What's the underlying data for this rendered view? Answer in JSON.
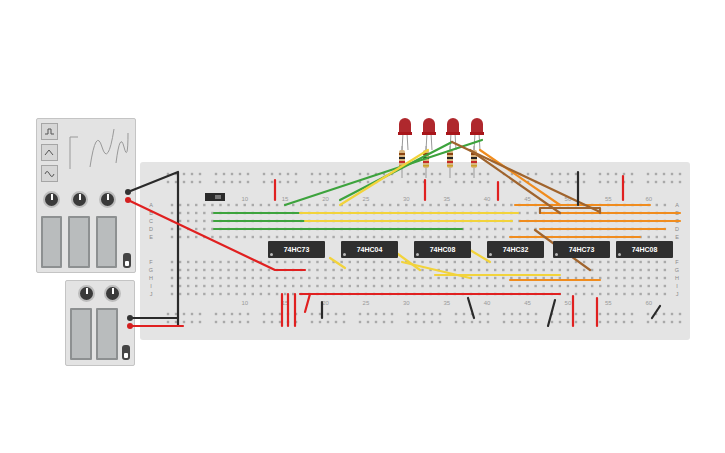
{
  "breadboard": {
    "column_labels_top": [
      "10",
      "15",
      "20",
      "25",
      "30",
      "35",
      "40",
      "45",
      "50",
      "55",
      "60"
    ],
    "column_labels_bottom": [
      "10",
      "15",
      "20",
      "25",
      "30",
      "35",
      "40",
      "45",
      "50",
      "55",
      "60"
    ],
    "rows_top": [
      "A",
      "B",
      "C",
      "D",
      "E"
    ],
    "rows_bottom": [
      "F",
      "G",
      "H",
      "I",
      "J"
    ]
  },
  "chips": [
    {
      "label": "74HC73"
    },
    {
      "label": "74HC04"
    },
    {
      "label": "74HC08"
    },
    {
      "label": "74HC32"
    },
    {
      "label": "74HC73"
    },
    {
      "label": "74HC08"
    }
  ],
  "leds": [
    {
      "color": "#a8161b",
      "on": false
    },
    {
      "color": "#a8161b",
      "on": false
    },
    {
      "color": "#a8161b",
      "on": false
    },
    {
      "color": "#a8161b",
      "on": false
    }
  ],
  "wires": [
    {
      "color": "#3da33d"
    },
    {
      "color": "#3da33d"
    },
    {
      "color": "#3da33d"
    },
    {
      "color": "#3da33d"
    },
    {
      "color": "#3da33d"
    },
    {
      "color": "#f2d33b"
    },
    {
      "color": "#f2d33b"
    },
    {
      "color": "#f2d33b"
    },
    {
      "color": "#f2d33b"
    },
    {
      "color": "#f2d33b"
    },
    {
      "color": "#f2d33b"
    },
    {
      "color": "#f2d33b"
    },
    {
      "color": "#f2d33b"
    },
    {
      "color": "#f08c1e"
    },
    {
      "color": "#f08c1e"
    },
    {
      "color": "#f08c1e"
    },
    {
      "color": "#f08c1e"
    },
    {
      "color": "#f08c1e"
    },
    {
      "color": "#f08c1e"
    },
    {
      "color": "#f08c1e"
    },
    {
      "color": "#a0642d"
    },
    {
      "color": "#a0642d"
    },
    {
      "color": "#a0642d"
    },
    {
      "color": "#a0642d"
    },
    {
      "color": "#e02020"
    },
    {
      "color": "#e02020"
    },
    {
      "color": "#e02020"
    },
    {
      "color": "#e02020"
    },
    {
      "color": "#2a2a2a"
    },
    {
      "color": "#2a2a2a"
    },
    {
      "color": "#e02020"
    },
    {
      "color": "#2a2a2a"
    },
    {
      "color": "#e02020"
    },
    {
      "color": "#e02020"
    },
    {
      "color": "#e02020"
    },
    {
      "color": "#e02020"
    },
    {
      "color": "#e02020"
    },
    {
      "color": "#e02020"
    },
    {
      "color": "#e02020"
    },
    {
      "color": "#2a2a2a"
    },
    {
      "color": "#2a2a2a"
    },
    {
      "color": "#2a2a2a"
    },
    {
      "color": "#2a2a2a"
    },
    {
      "color": "#e02020"
    }
  ]
}
